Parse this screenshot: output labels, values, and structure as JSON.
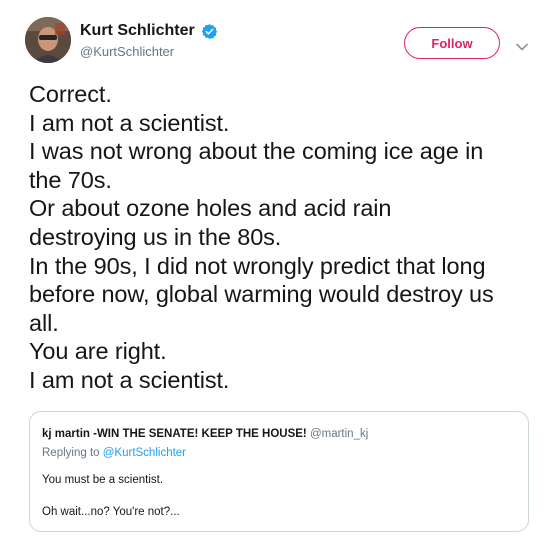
{
  "author": {
    "display_name": "Kurt Schlichter",
    "handle": "@KurtSchlichter",
    "verified": true
  },
  "actions": {
    "follow_label": "Follow"
  },
  "tweet": {
    "lines": [
      "Correct.",
      "I am not a scientist.",
      "I was not wrong about the coming ice age in",
      "the 70s.",
      "Or about ozone holes and acid rain",
      "destroying us in the 80s.",
      "In the 90s, I did not wrongly predict that long",
      "before now, global warming would destroy us",
      "all.",
      "You are right.",
      "I am not a scientist."
    ]
  },
  "quoted_tweet": {
    "display_name": "kj martin -WIN THE SENATE! KEEP THE HOUSE!",
    "handle": "@martin_kj",
    "replying_prefix": "Replying to",
    "replying_to": "@KurtSchlichter",
    "body_lines": [
      "You must be a scientist.",
      "Oh wait...no? You're not?..."
    ]
  },
  "colors": {
    "follow_accent": "#e0245e",
    "verified_blue": "#1da1f2",
    "link_blue": "#1da1f2",
    "secondary_text": "#657786"
  },
  "icons": {
    "verified": "verified-badge-icon",
    "menu": "chevron-down-icon"
  }
}
